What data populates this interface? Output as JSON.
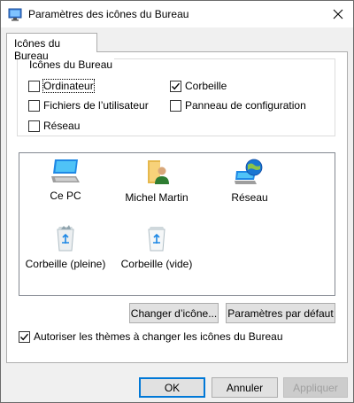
{
  "window": {
    "title": "Paramètres des icônes du Bureau"
  },
  "tabs": [
    {
      "label": "Icônes du Bureau"
    }
  ],
  "group": {
    "title": "Icônes du Bureau",
    "checkboxes": [
      {
        "label": "Ordinateur",
        "checked": false
      },
      {
        "label": "Corbeille",
        "checked": true
      },
      {
        "label": "Fichiers de l’utilisateur",
        "checked": false
      },
      {
        "label": "Panneau de configuration",
        "checked": false
      },
      {
        "label": "Réseau",
        "checked": false
      }
    ]
  },
  "icons": [
    {
      "label": "Ce PC",
      "icon": "computer-icon"
    },
    {
      "label": "Michel Martin",
      "icon": "user-folder-icon"
    },
    {
      "label": "Réseau",
      "icon": "network-icon"
    },
    {
      "label": "Corbeille (pleine)",
      "icon": "recycle-bin-full-icon"
    },
    {
      "label": "Corbeille (vide)",
      "icon": "recycle-bin-empty-icon"
    }
  ],
  "buttons": {
    "change_icon": "Changer d’icône...",
    "default_params": "Paramètres par défaut",
    "ok": "OK",
    "cancel": "Annuler",
    "apply": "Appliquer"
  },
  "theme_checkbox": {
    "label": "Autoriser les thèmes à changer les icônes du Bureau",
    "checked": true
  },
  "colors": {
    "accent": "#0078d7",
    "window_bg": "#f0f0f0",
    "panel_bg": "#ffffff"
  }
}
